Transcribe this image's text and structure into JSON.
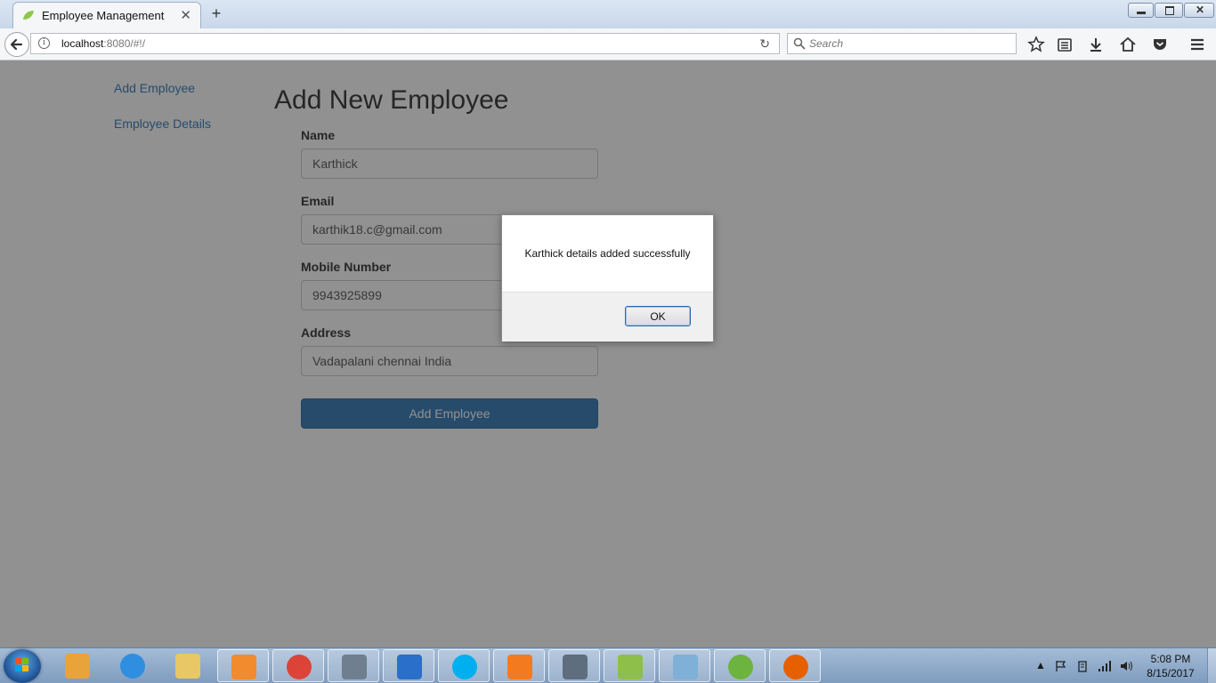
{
  "browser": {
    "tab_title": "Employee Management",
    "new_tab_label": "+",
    "url_host": "localhost",
    "url_rest": ":8080/#!/",
    "search_placeholder": "Search"
  },
  "sidebar": {
    "items": [
      {
        "label": "Add Employee"
      },
      {
        "label": "Employee Details"
      }
    ]
  },
  "form": {
    "title": "Add New Employee",
    "fields": [
      {
        "label": "Name",
        "value": "Karthick"
      },
      {
        "label": "Email",
        "value": "karthik18.c@gmail.com"
      },
      {
        "label": "Mobile Number",
        "value": "9943925899"
      },
      {
        "label": "Address",
        "value": "Vadapalani chennai India"
      }
    ],
    "submit_label": "Add Employee"
  },
  "dialog": {
    "message": "Karthick details added successfully",
    "ok_label": "OK"
  },
  "taskbar": {
    "items": [
      {
        "icon": "outlook-icon",
        "color": "#e8a33a"
      },
      {
        "icon": "internet-explorer-icon",
        "color": "#2f8ee0"
      },
      {
        "icon": "file-explorer-icon",
        "color": "#e8c864"
      },
      {
        "icon": "media-player-icon",
        "color": "#f28a2e"
      },
      {
        "icon": "chrome-icon",
        "color": "#db4437"
      },
      {
        "icon": "news-app-icon",
        "color": "#6f7f8f"
      },
      {
        "icon": "lync-icon",
        "color": "#2a6fc9"
      },
      {
        "icon": "skype-icon",
        "color": "#00aff0"
      },
      {
        "icon": "xampp-icon",
        "color": "#f47a20"
      },
      {
        "icon": "window-app-icon",
        "color": "#5e6e7e"
      },
      {
        "icon": "notepad-plus-icon",
        "color": "#8dbf4a"
      },
      {
        "icon": "notepad-icon",
        "color": "#7fb0d8"
      },
      {
        "icon": "spring-icon",
        "color": "#6db33f"
      },
      {
        "icon": "firefox-icon",
        "color": "#e66000"
      }
    ],
    "time": "5:08 PM",
    "date": "8/15/2017"
  }
}
